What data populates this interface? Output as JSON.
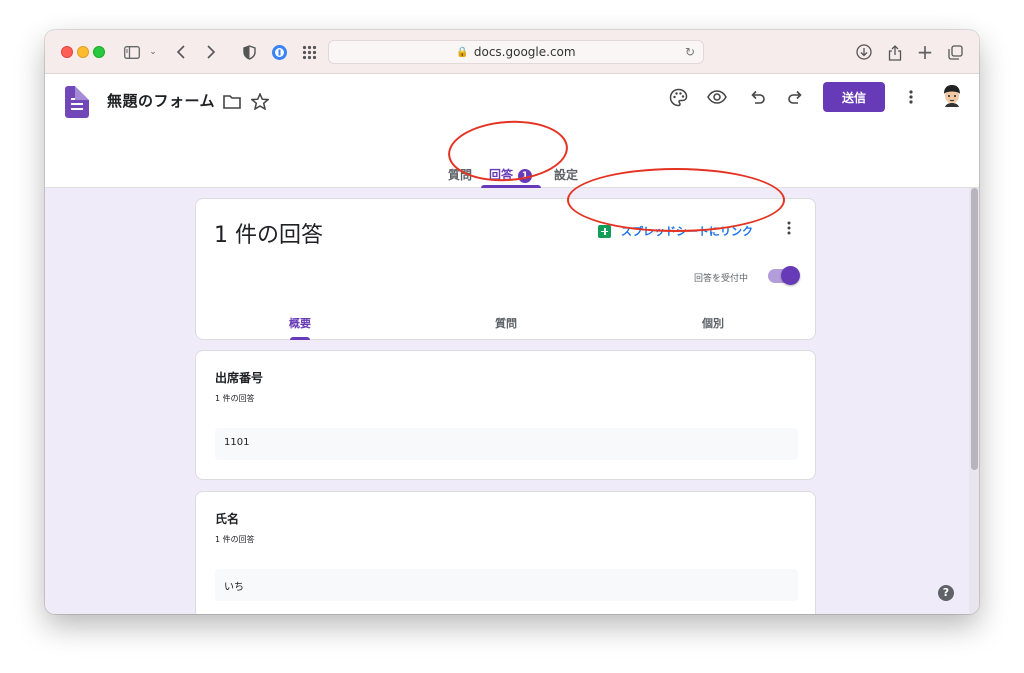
{
  "browser": {
    "url": "docs.google.com"
  },
  "form": {
    "title": "無題のフォーム",
    "send_label": "送信"
  },
  "tabs": [
    {
      "label": "質問"
    },
    {
      "label": "回答",
      "badge": "1"
    },
    {
      "label": "設定"
    }
  ],
  "responses": {
    "count_label": "1 件の回答",
    "sheet_link_label": "スプレッドシートにリンク",
    "accepting_label": "回答を受付中",
    "accepting_enabled": true,
    "sub_tabs": [
      {
        "label": "概要"
      },
      {
        "label": "質問"
      },
      {
        "label": "個別"
      }
    ]
  },
  "questions": [
    {
      "title": "出席番号",
      "count": "1 件の回答",
      "answer": "1101"
    },
    {
      "title": "氏名",
      "count": "1 件の回答",
      "answer": "いち"
    }
  ],
  "icons": {
    "folder": "folder-icon",
    "star": "star-icon",
    "palette": "palette-icon",
    "preview": "eye-icon",
    "undo": "undo-icon",
    "redo": "redo-icon",
    "more": "more-vert-icon",
    "help": "help-icon"
  },
  "colors": {
    "accent": "#673ab7",
    "link": "#1a73e8",
    "sheets": "#0f9d58",
    "annotation": "#e53323",
    "background": "#f0ebf8"
  }
}
